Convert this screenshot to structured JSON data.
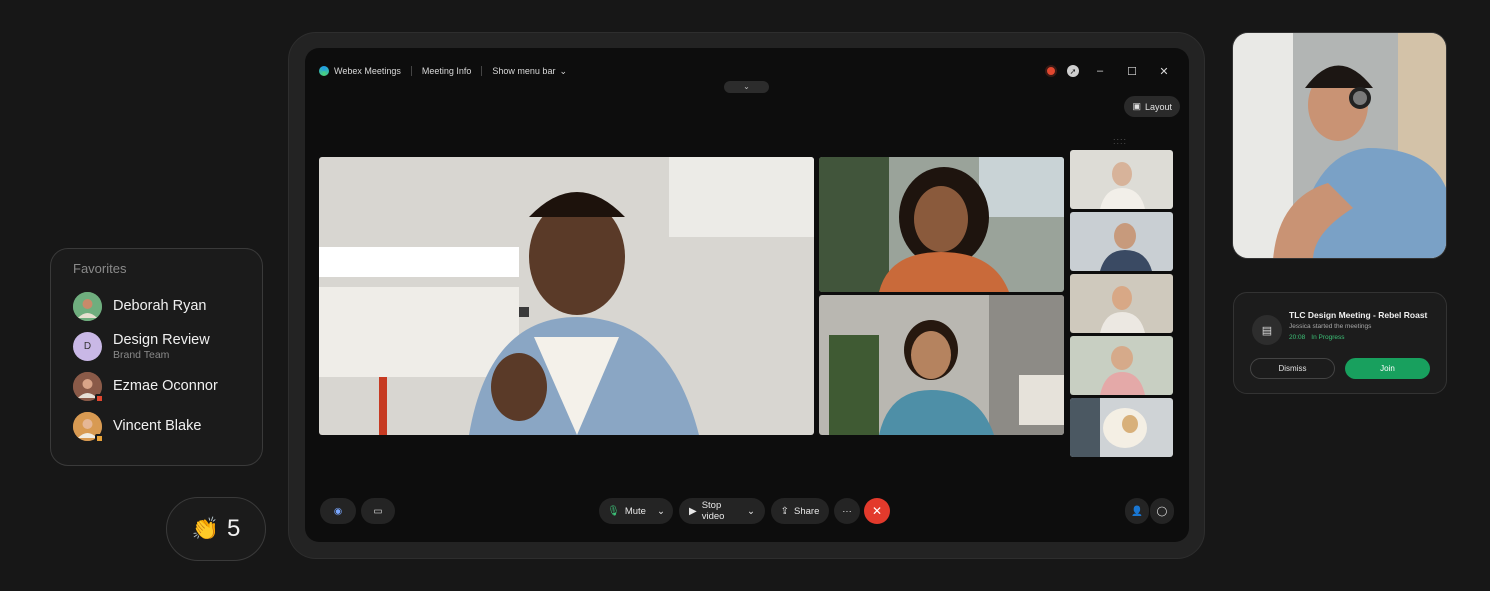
{
  "favorites": {
    "title": "Favorites",
    "items": [
      {
        "name": "Deborah Ryan",
        "sub": "",
        "avatar_color": "#6fae7e",
        "presence": ""
      },
      {
        "name": "Design Review",
        "sub": "Brand Team",
        "initial": "D",
        "avatar_color": "#c9b8e6",
        "presence": ""
      },
      {
        "name": "Ezmae Oconnor",
        "sub": "",
        "avatar_color": "#8a5a48",
        "presence": "#e0472f"
      },
      {
        "name": "Vincent Blake",
        "sub": "",
        "avatar_color": "#d89a52",
        "presence": "#e8a23a"
      }
    ]
  },
  "reactions": {
    "emoji": "👏",
    "count": "5"
  },
  "meeting_window": {
    "app_name": "Webex Meetings",
    "meeting_info": "Meeting Info",
    "show_menu_bar": "Show menu bar",
    "layout_label": "Layout",
    "controls": {
      "mute": "Mute",
      "stop_video": "Stop video",
      "share": "Share"
    }
  },
  "notification": {
    "title": "TLC Design Meeting - Rebel Roast",
    "subtitle": "Jessica started the meetings",
    "time": "20:08",
    "status": "In Progress",
    "dismiss": "Dismiss",
    "join": "Join"
  },
  "colors": {
    "background": "#171717",
    "accent_green": "#18a05e",
    "end_call_red": "#e33a2c",
    "recording_red": "#e0472f"
  }
}
